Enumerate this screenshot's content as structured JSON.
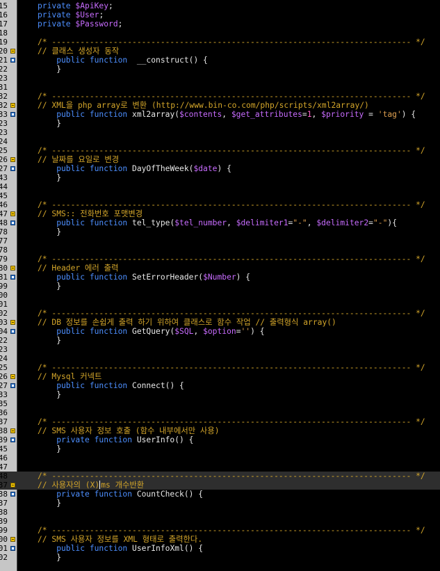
{
  "editor": {
    "lines": [
      {
        "n": "15",
        "segs": [
          {
            "t": "private ",
            "c": "kw"
          },
          {
            "t": "$ApiKey",
            "c": "var"
          },
          {
            "t": ";",
            "c": "fn"
          }
        ]
      },
      {
        "n": "16",
        "segs": [
          {
            "t": "private ",
            "c": "kw"
          },
          {
            "t": "$User",
            "c": "var"
          },
          {
            "t": ";",
            "c": "fn"
          }
        ]
      },
      {
        "n": "17",
        "segs": [
          {
            "t": "private ",
            "c": "kw"
          },
          {
            "t": "$Password",
            "c": "var"
          },
          {
            "t": ";",
            "c": "fn"
          }
        ]
      },
      {
        "n": "18",
        "segs": []
      },
      {
        "n": "19",
        "segs": [
          {
            "t": "/* ---------------------------------------------------------------------------- */",
            "c": "cmt"
          }
        ]
      },
      {
        "n": "20",
        "m": "fold",
        "segs": [
          {
            "t": "// 클래스 생성자 동작",
            "c": "cmt"
          }
        ]
      },
      {
        "n": "21",
        "m": "member",
        "segs": [
          {
            "t": "    public function ",
            "c": "kw"
          },
          {
            "t": " __construct() {",
            "c": "fn"
          }
        ]
      },
      {
        "n": "22",
        "segs": [
          {
            "t": "    }",
            "c": "fn"
          }
        ]
      },
      {
        "n": "23",
        "segs": []
      },
      {
        "n": "31",
        "segs": []
      },
      {
        "n": "32",
        "segs": [
          {
            "t": "/* ---------------------------------------------------------------------------- */",
            "c": "cmt"
          }
        ]
      },
      {
        "n": "32",
        "m": "fold",
        "segs": [
          {
            "t": "// XML을 php array로 변환 (http://www.bin-co.com/php/scripts/xml2array/)",
            "c": "cmt"
          }
        ]
      },
      {
        "n": "33",
        "m": "member",
        "segs": [
          {
            "t": "    public function ",
            "c": "kw"
          },
          {
            "t": "xml2array(",
            "c": "fn"
          },
          {
            "t": "$contents",
            "c": "var"
          },
          {
            "t": ", ",
            "c": "fn"
          },
          {
            "t": "$get_attributes",
            "c": "var"
          },
          {
            "t": "=",
            "c": "fn"
          },
          {
            "t": "1",
            "c": "num"
          },
          {
            "t": ", ",
            "c": "fn"
          },
          {
            "t": "$priority",
            "c": "var"
          },
          {
            "t": " = ",
            "c": "fn"
          },
          {
            "t": "'tag'",
            "c": "str"
          },
          {
            "t": ") {",
            "c": "fn"
          }
        ]
      },
      {
        "n": "23",
        "segs": [
          {
            "t": "    }",
            "c": "fn"
          }
        ]
      },
      {
        "n": "23",
        "segs": []
      },
      {
        "n": "24",
        "segs": []
      },
      {
        "n": "25",
        "segs": [
          {
            "t": "/* ---------------------------------------------------------------------------- */",
            "c": "cmt"
          }
        ]
      },
      {
        "n": "26",
        "m": "fold",
        "segs": [
          {
            "t": "// 날짜를 요일로 변경",
            "c": "cmt"
          }
        ]
      },
      {
        "n": "27",
        "m": "member",
        "segs": [
          {
            "t": "    public function ",
            "c": "kw"
          },
          {
            "t": "DayOfTheWeek(",
            "c": "fn"
          },
          {
            "t": "$date",
            "c": "var"
          },
          {
            "t": ") {",
            "c": "fn"
          }
        ]
      },
      {
        "n": "43",
        "segs": [
          {
            "t": "    }",
            "c": "fn"
          }
        ]
      },
      {
        "n": "44",
        "segs": []
      },
      {
        "n": "45",
        "segs": []
      },
      {
        "n": "46",
        "segs": [
          {
            "t": "/* ---------------------------------------------------------------------------- */",
            "c": "cmt"
          }
        ]
      },
      {
        "n": "47",
        "m": "fold",
        "segs": [
          {
            "t": "// SMS:: 전화번호 포맷변경",
            "c": "cmt"
          }
        ]
      },
      {
        "n": "48",
        "m": "member",
        "segs": [
          {
            "t": "    public function ",
            "c": "kw"
          },
          {
            "t": "tel_type(",
            "c": "fn"
          },
          {
            "t": "$tel_number",
            "c": "var"
          },
          {
            "t": ", ",
            "c": "fn"
          },
          {
            "t": "$delimiter1",
            "c": "var"
          },
          {
            "t": "=",
            "c": "fn"
          },
          {
            "t": "\"-\"",
            "c": "str"
          },
          {
            "t": ", ",
            "c": "fn"
          },
          {
            "t": "$delimiter2",
            "c": "var"
          },
          {
            "t": "=",
            "c": "fn"
          },
          {
            "t": "\"-\"",
            "c": "str"
          },
          {
            "t": "){",
            "c": "fn"
          }
        ]
      },
      {
        "n": "78",
        "segs": [
          {
            "t": "    }",
            "c": "fn"
          }
        ]
      },
      {
        "n": "77",
        "segs": []
      },
      {
        "n": "78",
        "segs": []
      },
      {
        "n": "79",
        "segs": [
          {
            "t": "/* ---------------------------------------------------------------------------- */",
            "c": "cmt"
          }
        ]
      },
      {
        "n": "80",
        "m": "fold",
        "segs": [
          {
            "t": "// Header 에러 출력",
            "c": "cmt"
          }
        ]
      },
      {
        "n": "81",
        "m": "member",
        "segs": [
          {
            "t": "    public function ",
            "c": "kw"
          },
          {
            "t": "SetErrorHeader(",
            "c": "fn"
          },
          {
            "t": "$Number",
            "c": "var"
          },
          {
            "t": ") {",
            "c": "fn"
          }
        ]
      },
      {
        "n": "99",
        "segs": [
          {
            "t": "    }",
            "c": "fn"
          }
        ]
      },
      {
        "n": "00",
        "segs": []
      },
      {
        "n": "01",
        "segs": []
      },
      {
        "n": "02",
        "segs": [
          {
            "t": "/* ---------------------------------------------------------------------------- */",
            "c": "cmt"
          }
        ]
      },
      {
        "n": "03",
        "m": "fold",
        "segs": [
          {
            "t": "// DB 정보를 손쉽게 출력 하기 위하여 클래스로 함수 작업 // 출력형식 array()",
            "c": "cmt"
          }
        ]
      },
      {
        "n": "04",
        "m": "member",
        "segs": [
          {
            "t": "    public function ",
            "c": "kw"
          },
          {
            "t": "GetQuery(",
            "c": "fn"
          },
          {
            "t": "$SQL",
            "c": "var"
          },
          {
            "t": ", ",
            "c": "fn"
          },
          {
            "t": "$option",
            "c": "var"
          },
          {
            "t": "=",
            "c": "fn"
          },
          {
            "t": "''",
            "c": "str"
          },
          {
            "t": ") {",
            "c": "fn"
          }
        ]
      },
      {
        "n": "22",
        "segs": [
          {
            "t": "    }",
            "c": "fn"
          }
        ]
      },
      {
        "n": "23",
        "segs": []
      },
      {
        "n": "24",
        "segs": []
      },
      {
        "n": "25",
        "segs": [
          {
            "t": "/* ---------------------------------------------------------------------------- */",
            "c": "cmt"
          }
        ]
      },
      {
        "n": "26",
        "m": "fold",
        "segs": [
          {
            "t": "// Mysql 커넥트",
            "c": "cmt"
          }
        ]
      },
      {
        "n": "27",
        "m": "member",
        "segs": [
          {
            "t": "    public function ",
            "c": "kw"
          },
          {
            "t": "Connect() {",
            "c": "fn"
          }
        ]
      },
      {
        "n": "33",
        "segs": [
          {
            "t": "    }",
            "c": "fn"
          }
        ]
      },
      {
        "n": "35",
        "segs": []
      },
      {
        "n": "36",
        "segs": []
      },
      {
        "n": "37",
        "segs": [
          {
            "t": "/* ---------------------------------------------------------------------------- */",
            "c": "cmt"
          }
        ]
      },
      {
        "n": "38",
        "m": "fold",
        "segs": [
          {
            "t": "// SMS 사용자 정보 호출 (함수 내부에서만 사용)",
            "c": "cmt"
          }
        ]
      },
      {
        "n": "39",
        "m": "member",
        "segs": [
          {
            "t": "    private function ",
            "c": "kw"
          },
          {
            "t": "UserInfo() {",
            "c": "fn"
          }
        ]
      },
      {
        "n": "45",
        "segs": [
          {
            "t": "    }",
            "c": "fn"
          }
        ]
      },
      {
        "n": "46",
        "segs": []
      },
      {
        "n": "47",
        "segs": []
      },
      {
        "n": "48",
        "current": true,
        "segs": [
          {
            "t": "/* ---------------------------------------------------------------------------- */",
            "c": "cmt"
          }
        ]
      },
      {
        "n": "37",
        "m": "fold",
        "current": true,
        "caret": true,
        "segs": [
          {
            "t": "// 사용자의 (X)",
            "c": "cmt"
          },
          {
            "t": "ms 개수반환",
            "c": "cmt"
          }
        ]
      },
      {
        "n": "38",
        "m": "member",
        "segs": [
          {
            "t": "    private function ",
            "c": "kw"
          },
          {
            "t": "CountCheck() {",
            "c": "fn"
          }
        ]
      },
      {
        "n": "37",
        "segs": [
          {
            "t": "    }",
            "c": "fn"
          }
        ]
      },
      {
        "n": "38",
        "segs": []
      },
      {
        "n": "39",
        "segs": []
      },
      {
        "n": "99",
        "segs": [
          {
            "t": "/* ---------------------------------------------------------------------------- */",
            "c": "cmt"
          }
        ]
      },
      {
        "n": "00",
        "m": "fold",
        "segs": [
          {
            "t": "// SMS 사용자 정보를 XML 형태로 출력한다.",
            "c": "cmt"
          }
        ]
      },
      {
        "n": "01",
        "m": "member",
        "segs": [
          {
            "t": "    public function ",
            "c": "kw"
          },
          {
            "t": "UserInfoXml() {",
            "c": "fn"
          }
        ]
      },
      {
        "n": "02",
        "segs": [
          {
            "t": "    }",
            "c": "fn"
          }
        ]
      }
    ]
  }
}
